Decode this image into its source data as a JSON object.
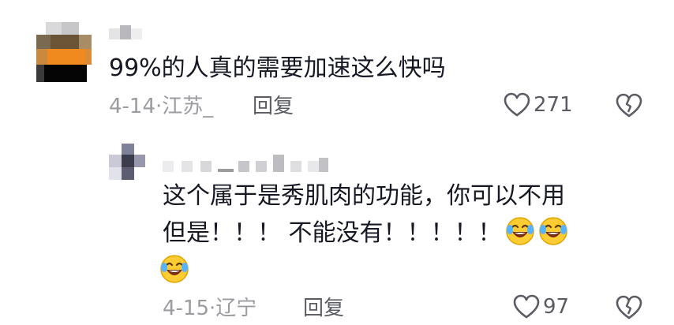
{
  "comments": [
    {
      "text": "99%的人真的需要加速这么快吗",
      "date_location": "4-14·江苏_",
      "reply_label": "回复",
      "like_count": "271",
      "like_icon": "heart-outline-icon",
      "dislike_icon": "broken-heart-icon"
    }
  ],
  "replies": [
    {
      "line1": "这个属于是秀肌肉的功能，你可以不用",
      "line2": "但是！！！ 不能没有！！！！！",
      "emojis": [
        "rolling-laughing-emoji",
        "rolling-laughing-emoji",
        "rolling-laughing-emoji"
      ],
      "date_location": "4-15·辽宁",
      "reply_label": "回复",
      "like_count": "97",
      "like_icon": "heart-outline-icon",
      "dislike_icon": "broken-heart-icon"
    }
  ],
  "colors": {
    "text": "#161823",
    "meta": "#9b9ca1",
    "action": "#5b5c63"
  }
}
